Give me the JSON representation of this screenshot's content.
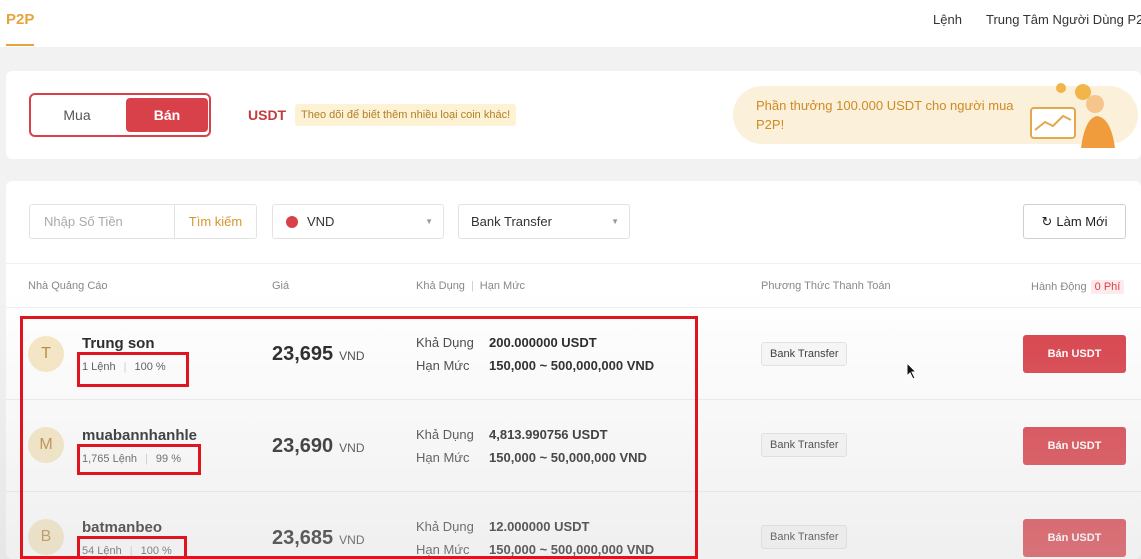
{
  "nav": {
    "brand": "P2P",
    "orders": "Lệnh",
    "user_center": "Trung Tâm Người Dùng P2"
  },
  "banner": {
    "buy_label": "Mua",
    "sell_label": "Bán",
    "coin": "USDT",
    "coin_tip": "Theo dõi để biết thêm nhiều loại coin khác!",
    "promo_text": "Phần thưởng 100.000 USDT cho người mua P2P!"
  },
  "filters": {
    "amount_placeholder": "Nhập Số Tiền",
    "search_label": "Tìm kiếm",
    "currency": "VND",
    "payment_method": "Bank Transfer",
    "refresh_label": "Làm Mới"
  },
  "table": {
    "headers": {
      "advertiser": "Nhà Quảng Cáo",
      "price": "Giá",
      "available": "Khả Dụng",
      "limit": "Hạn Mức",
      "payment": "Phương Thức Thanh Toán",
      "action": "Hành Động",
      "fee": "0 Phí"
    },
    "available_label": "Khả Dụng",
    "limit_label": "Hạn Mức",
    "price_unit": "VND",
    "rows": [
      {
        "initial": "T",
        "name": "Trung son",
        "orders": "1 Lệnh",
        "completion": "100 %",
        "price": "23,695",
        "available": "200.000000 USDT",
        "limit": "150,000 ~ 500,000,000 VND",
        "payment": "Bank Transfer",
        "action": "Bán USDT"
      },
      {
        "initial": "M",
        "name": "muabannhanhle",
        "orders": "1,765 Lệnh",
        "completion": "99 %",
        "price": "23,690",
        "available": "4,813.990756 USDT",
        "limit": "150,000 ~ 50,000,000 VND",
        "payment": "Bank Transfer",
        "action": "Bán USDT"
      },
      {
        "initial": "B",
        "name": "batmanbeo",
        "orders": "54 Lệnh",
        "completion": "100 %",
        "price": "23,685",
        "available": "12.000000 USDT",
        "limit": "150,000 ~ 500,000,000 VND",
        "payment": "Bank Transfer",
        "action": "Bán USDT"
      }
    ]
  },
  "colors": {
    "accent": "#e8a33a",
    "sell": "#d9414a",
    "annotation": "#e0141e"
  }
}
